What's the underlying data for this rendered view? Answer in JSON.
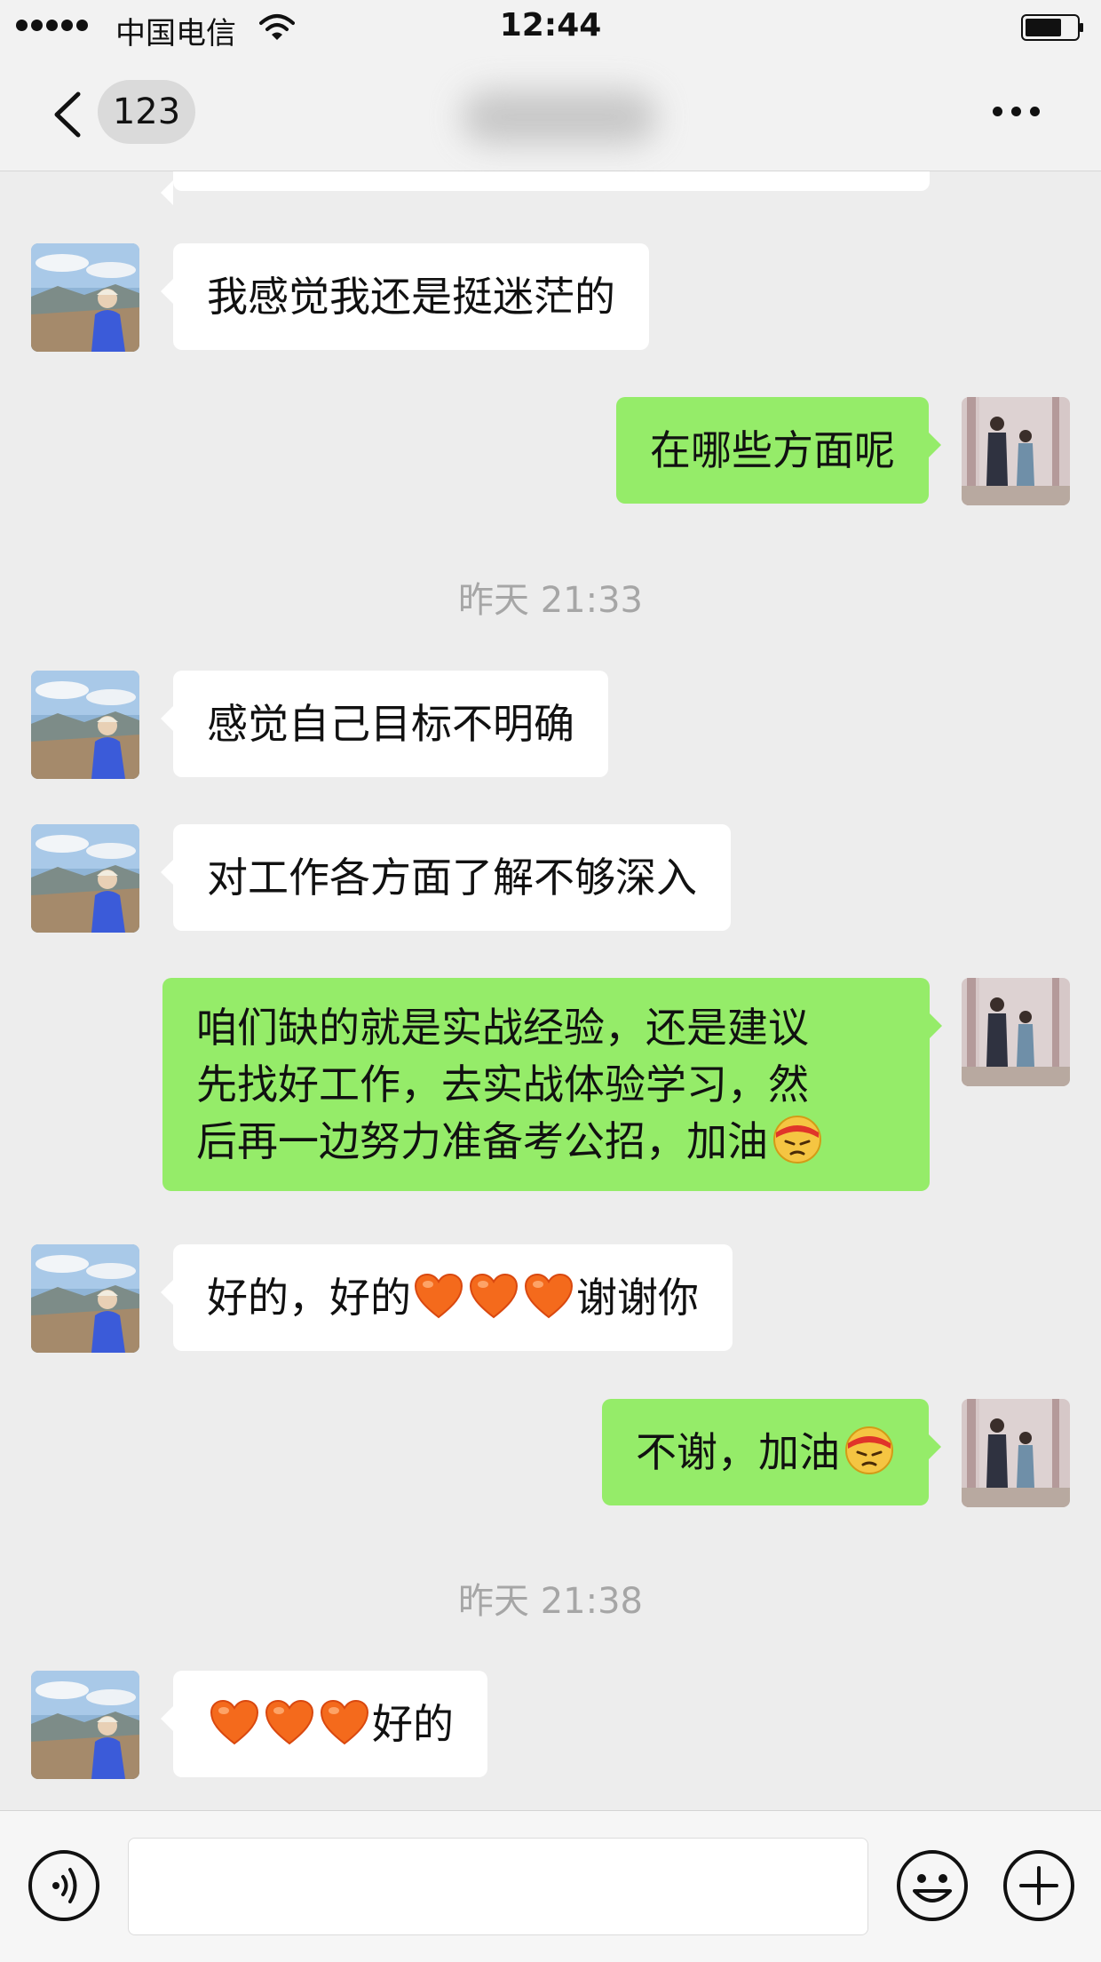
{
  "status_bar": {
    "carrier": "中国电信",
    "time": "12:44"
  },
  "nav": {
    "unread_count": "123"
  },
  "messages": {
    "m1": "我感觉我还是挺迷茫的",
    "m2": "在哪些方面呢",
    "ts1": "昨天 21:33",
    "m3": "感觉自己目标不明确",
    "m4": "对工作各方面了解不够深入",
    "m5_line1": "咱们缺的就是实战经验，还是建议",
    "m5_line2": "先找好工作，去实战体验学习，然",
    "m5_line3": "后再一边努力准备考公招，加油",
    "m6_start": "好的，好的",
    "m6_end": "谢谢你",
    "m7": "不谢，加油",
    "ts2": "昨天 21:38",
    "m8_end": "好的"
  },
  "icons": {
    "heart": "orange-heart",
    "emoji": "determined-face-headband",
    "voice": "voice-icon",
    "emoji_button": "smiley-icon",
    "plus": "plus-icon"
  },
  "colors": {
    "sent_bubble": "#95ec69",
    "received_bubble": "#ffffff",
    "background": "#ededed"
  },
  "input": {
    "placeholder": ""
  }
}
